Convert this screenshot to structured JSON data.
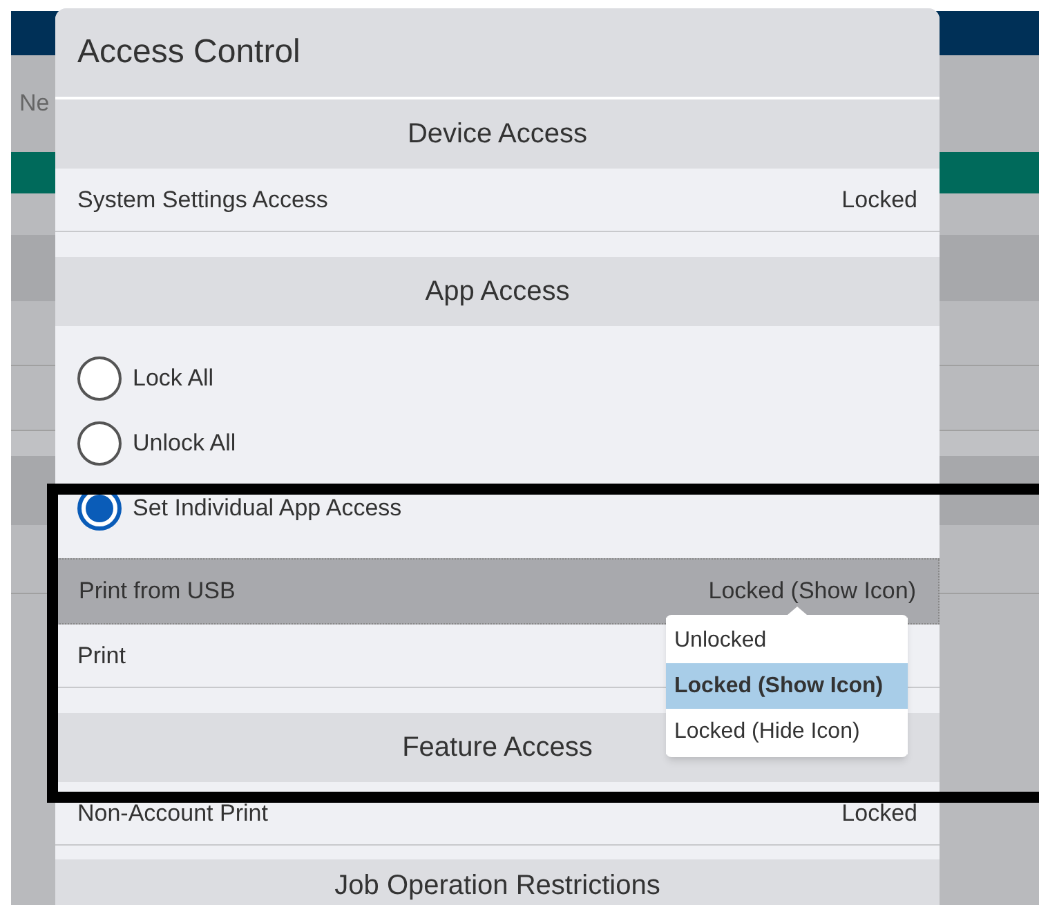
{
  "background_page": {
    "cut_text": "Ne"
  },
  "dialog": {
    "title": "Access Control",
    "sections": [
      {
        "header": "Device Access",
        "items": [
          {
            "kind": "setting",
            "label": "System Settings Access",
            "value": "Locked",
            "selected": false
          }
        ]
      },
      {
        "header": "App Access",
        "items": [
          {
            "kind": "radio",
            "label": "Lock All",
            "selected": false
          },
          {
            "kind": "radio",
            "label": "Unlock All",
            "selected": false
          },
          {
            "kind": "radio",
            "label": "Set Individual App Access",
            "selected": true
          },
          {
            "kind": "setting",
            "label": "Print from USB",
            "value": "Locked (Show Icon)",
            "selected": true
          },
          {
            "kind": "setting",
            "label": "Print",
            "selected": false
          }
        ]
      },
      {
        "header": "Feature Access",
        "items": [
          {
            "kind": "setting",
            "label": "Non-Account Print",
            "value": "Locked",
            "selected": false
          }
        ]
      },
      {
        "header": "Job Operation Restrictions"
      }
    ]
  },
  "dropdown": {
    "options": [
      {
        "label": "Unlocked",
        "selected": false
      },
      {
        "label": "Locked (Show Icon)",
        "selected": true
      },
      {
        "label": "Locked (Hide Icon)",
        "selected": false
      }
    ]
  }
}
